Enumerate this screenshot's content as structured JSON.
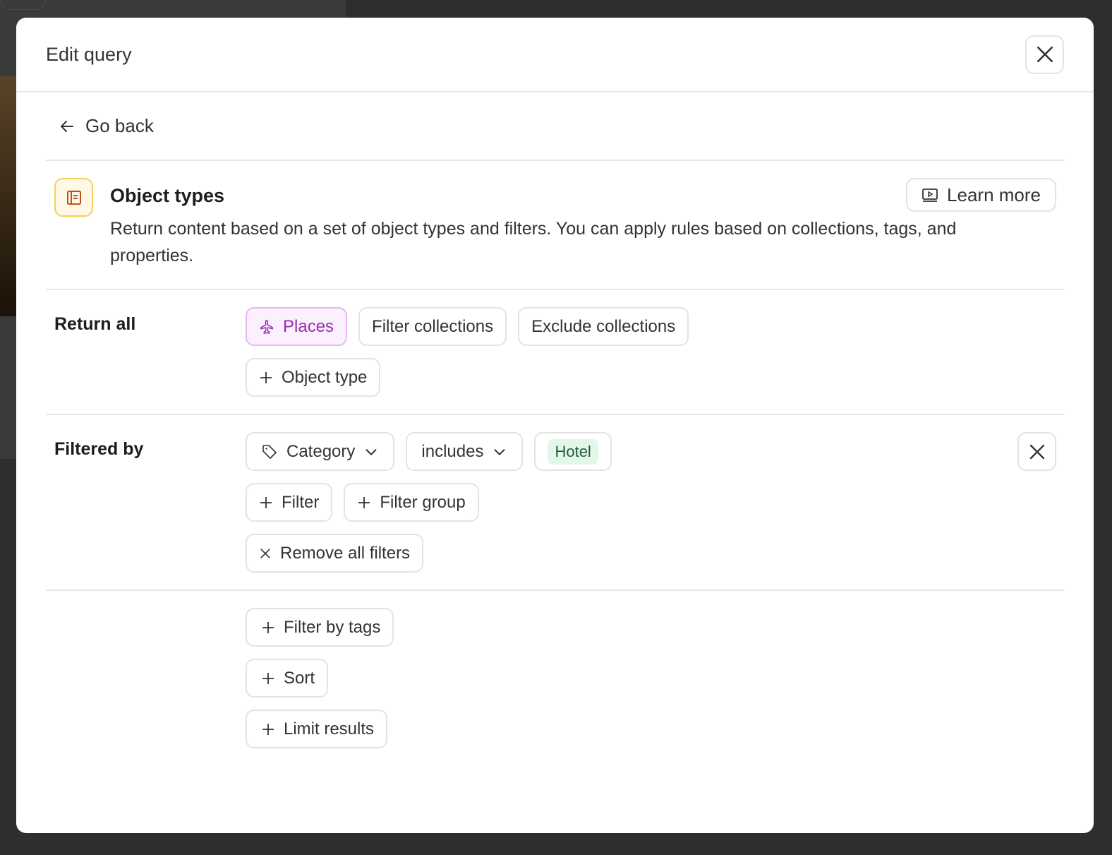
{
  "modal": {
    "title": "Edit query",
    "go_back": "Go back",
    "intro": {
      "title": "Object types",
      "description": "Return content based on a set of object types and filters. You can apply rules based on collections, tags, and properties.",
      "learn_more": "Learn more"
    },
    "return_all": {
      "label": "Return all",
      "places": "Places",
      "filter_collections": "Filter collections",
      "exclude_collections": "Exclude collections",
      "add_object_type": "Object type"
    },
    "filtered_by": {
      "label": "Filtered by",
      "field": "Category",
      "operator": "includes",
      "value": "Hotel",
      "add_filter": "Filter",
      "add_filter_group": "Filter group",
      "remove_all": "Remove all filters"
    },
    "extras": {
      "filter_by_tags": "Filter by tags",
      "sort": "Sort",
      "limit_results": "Limit results"
    }
  },
  "colors": {
    "accent_purple": "#9b2bb3",
    "tag_green": "#e2f6ea",
    "icon_yellow": "#f3cf5e"
  }
}
